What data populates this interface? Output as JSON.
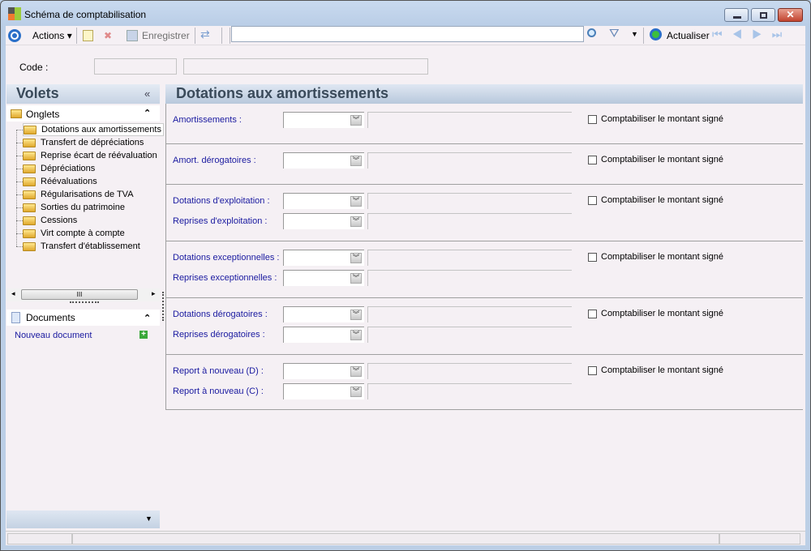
{
  "window": {
    "title": "Schéma de comptabilisation"
  },
  "toolbar": {
    "actions": "Actions",
    "save": "Enregistrer",
    "search_value": "",
    "refresh": "Actualiser"
  },
  "code": {
    "label": "Code :",
    "value": "",
    "description": ""
  },
  "left": {
    "title": "Volets",
    "onglets": {
      "title": "Onglets",
      "items": [
        "Dotations aux amortissements",
        "Transfert de dépréciations",
        "Reprise écart de réévaluation",
        "Dépréciations",
        "Réévaluations",
        "Régularisations de TVA",
        "Sorties du patrimoine",
        "Cessions",
        "Virt compte à compte",
        "Transfert d'établissement"
      ]
    },
    "documents": {
      "title": "Documents",
      "new_doc": "Nouveau document"
    }
  },
  "main": {
    "title": "Dotations aux amortissements",
    "checkbox_label": "Comptabiliser le montant signé",
    "fields": [
      "Amortissements  :",
      "Amort. dérogatoires :",
      "Dotations d'exploitation :",
      "Reprises d'exploitation :",
      "Dotations exceptionnelles :",
      "Reprises exceptionnelles :",
      "Dotations dérogatoires :",
      "Reprises dérogatoires :",
      "Report à nouveau (D) :",
      "Report à nouveau (C) :"
    ]
  }
}
